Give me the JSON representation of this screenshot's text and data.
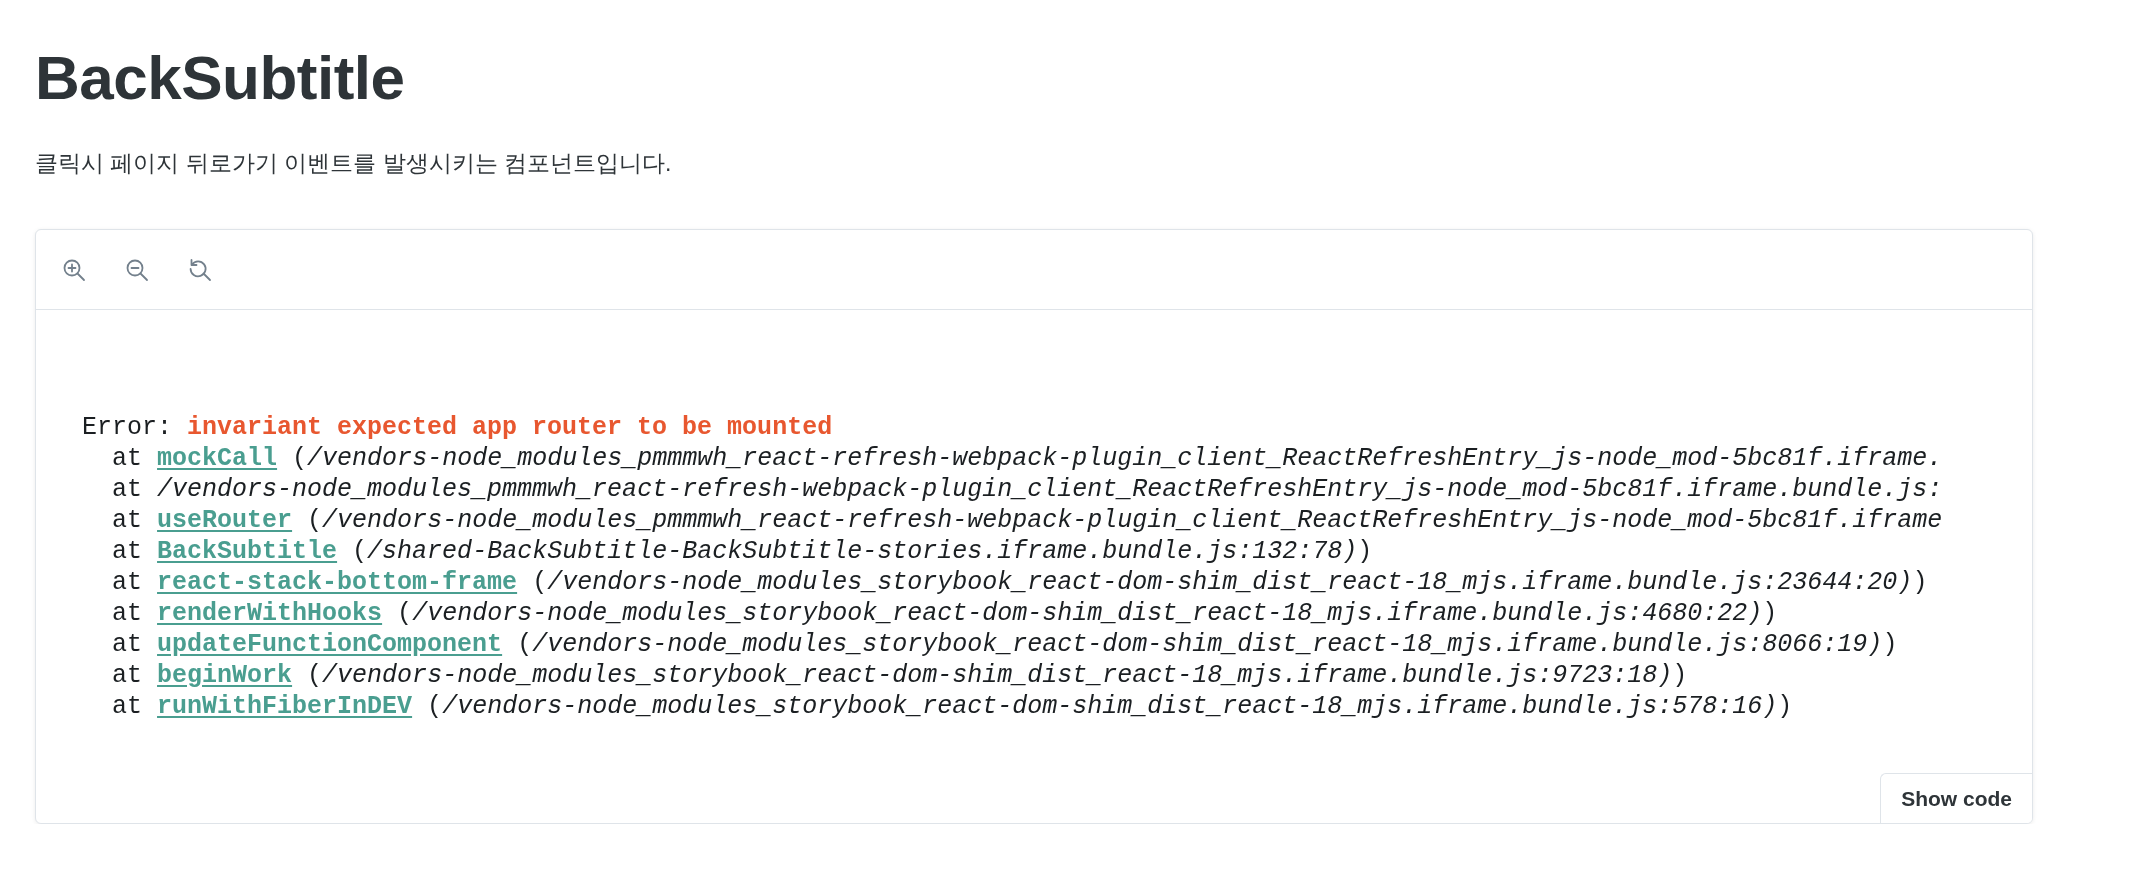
{
  "title": "BackSubtitle",
  "description": "클릭시 페이지 뒤로가기 이벤트를 발생시키는 컴포넌트입니다.",
  "toolbar": {
    "tools": [
      {
        "kind": "zoom-in"
      },
      {
        "kind": "zoom-out"
      },
      {
        "kind": "reset"
      }
    ]
  },
  "error": {
    "label": "Error:",
    "message": "invariant expected app router to be mounted",
    "frames": [
      {
        "prefix": "at",
        "function": "mockCall",
        "location": "(*/vendors-node_modules_pmmmwh_react-refresh-webpack-plugin_client_ReactRefreshEntry_js-node_mod-5bc81f.iframe.*"
      },
      {
        "prefix": "at",
        "location": "*/vendors-node_modules_pmmmwh_react-refresh-webpack-plugin_client_ReactRefreshEntry_js-node_mod-5bc81f.iframe.bundle.js:*"
      },
      {
        "prefix": "at",
        "function": "useRouter",
        "location": "(*/vendors-node_modules_pmmmwh_react-refresh-webpack-plugin_client_ReactRefreshEntry_js-node_mod-5bc81f.iframe*"
      },
      {
        "prefix": "at",
        "function": "BackSubtitle",
        "location": "(*/shared-BackSubtitle-BackSubtitle-stories.iframe.bundle.js:132:78)*)"
      },
      {
        "prefix": "at",
        "function": "react-stack-bottom-frame",
        "location": "(*/vendors-node_modules_storybook_react-dom-shim_dist_react-18_mjs.iframe.bundle.js:23644:20)*)"
      },
      {
        "prefix": "at",
        "function": "renderWithHooks",
        "location": "(*/vendors-node_modules_storybook_react-dom-shim_dist_react-18_mjs.iframe.bundle.js:4680:22)*)"
      },
      {
        "prefix": "at",
        "function": "updateFunctionComponent",
        "location": "(*/vendors-node_modules_storybook_react-dom-shim_dist_react-18_mjs.iframe.bundle.js:8066:19)*)"
      },
      {
        "prefix": "at",
        "function": "beginWork",
        "location": "(*/vendors-node_modules_storybook_react-dom-shim_dist_react-18_mjs.iframe.bundle.js:9723:18)*)"
      },
      {
        "prefix": "at",
        "function": "runWithFiberInDEV",
        "location": "(*/vendors-node_modules_storybook_react-dom-shim_dist_react-18_mjs.iframe.bundle.js:578:16)*)"
      }
    ]
  },
  "show_code_button": "Show code"
}
